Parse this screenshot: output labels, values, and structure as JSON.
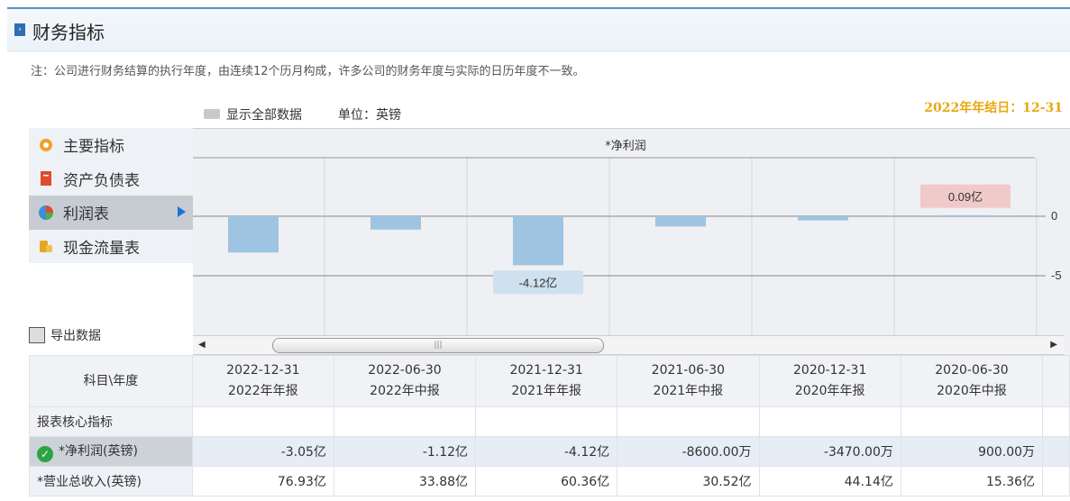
{
  "header": {
    "title": "财务指标",
    "note": "注：公司进行财务结算的执行年度，由连续12个历月构成，许多公司的财务年度与实际的日历年度不一致。"
  },
  "controls": {
    "show_all": "显示全部数据",
    "unit": "单位：英镑",
    "year_end": "2022年年结日：12-31"
  },
  "sidebar": {
    "items": [
      {
        "label": "主要指标",
        "icon": "gear-icon"
      },
      {
        "label": "资产负债表",
        "icon": "document-icon"
      },
      {
        "label": "利润表",
        "icon": "pie-chart-icon",
        "active": true
      },
      {
        "label": "现金流量表",
        "icon": "coins-icon"
      }
    ],
    "export_label": "导出数据"
  },
  "chart_data": {
    "type": "bar",
    "title": "*净利润",
    "categories": [
      "2022-12-31",
      "2022-06-30",
      "2021-12-31",
      "2021-06-30",
      "2020-12-31",
      "2020-06-30"
    ],
    "series": [
      {
        "name": "*净利润",
        "values": [
          -3.05,
          -1.12,
          -4.12,
          -0.86,
          -0.347,
          0.09
        ]
      }
    ],
    "y_ticks": [
      "0",
      "-5"
    ],
    "ylim": [
      -10,
      5
    ],
    "callouts": [
      {
        "index": 2,
        "text": "-4.12亿"
      },
      {
        "index": 5,
        "text": "0.09亿"
      }
    ],
    "bar_color": "#9ec4e2",
    "grid": true
  },
  "table": {
    "header_label": "科目\\年度",
    "columns": [
      {
        "date": "2022-12-31",
        "type": "2022年年报"
      },
      {
        "date": "2022-06-30",
        "type": "2022年中报"
      },
      {
        "date": "2021-12-31",
        "type": "2021年年报"
      },
      {
        "date": "2021-06-30",
        "type": "2021年中报"
      },
      {
        "date": "2020-12-31",
        "type": "2020年年报"
      },
      {
        "date": "2020-06-30",
        "type": "2020年中报"
      }
    ],
    "section_label": "报表核心指标",
    "rows": [
      {
        "label": "*净利润(英镑)",
        "values": [
          "-3.05亿",
          "-1.12亿",
          "-4.12亿",
          "-8600.00万",
          "-3470.00万",
          "900.00万"
        ]
      },
      {
        "label": "*营业总收入(英镑)",
        "values": [
          "76.93亿",
          "33.88亿",
          "60.36亿",
          "30.52亿",
          "44.14亿",
          "15.36亿"
        ]
      }
    ]
  }
}
